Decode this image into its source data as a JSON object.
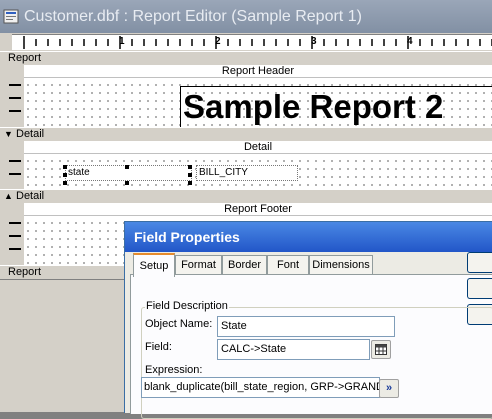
{
  "editor": {
    "title": "Customer.dbf : Report Editor (Sample Report 1)",
    "ruler_numbers": [
      "1",
      "2",
      "3",
      "4"
    ]
  },
  "bands": {
    "report_label": "Report",
    "report_header": "Report Header",
    "detail_label": "Detail",
    "detail_caption": "Detail",
    "detail_label2": "Detail",
    "report_footer": "Report Footer",
    "report_label2": "Report"
  },
  "report_title": "Sample Report 2",
  "detail_fields": {
    "state": "state",
    "city": "BILL_CITY"
  },
  "dialog": {
    "title": "Field Properties",
    "tabs": [
      "Setup",
      "Format",
      "Border",
      "Font",
      "Dimensions"
    ],
    "active_tab": "Setup",
    "group_title": "Field Description",
    "object_name_label": "Object Name:",
    "object_name_value": "State",
    "field_label": "Field:",
    "field_value": "CALC->State",
    "expression_label": "Expression:",
    "expression_value": "blank_duplicate(bill_state_region, GRP->GRAND",
    "expression_button": "»"
  },
  "colors": {
    "dialog_title_bar": "#2256c8",
    "editor_title_bar": "#8290a4",
    "active_tab_accent": "#e68b2c"
  }
}
